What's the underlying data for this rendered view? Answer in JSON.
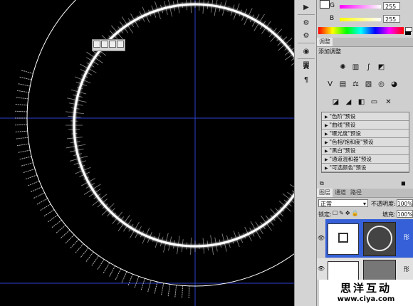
{
  "color_panel": {
    "g_label": "G",
    "g_value": "255",
    "b_label": "B",
    "b_value": "255"
  },
  "adjustments": {
    "tab_label": "调整",
    "title": "添加调整",
    "presets": [
      "\"色阶\"预设",
      "\"曲线\"预设",
      "\"曝光度\"预设",
      "\"色相/饱和度\"预设",
      "\"黑白\"预设",
      "\"通道混和器\"预设",
      "\"可选颜色\"预设"
    ]
  },
  "layers": {
    "tabs": [
      "图层",
      "通道",
      "路径"
    ],
    "blend_mode": "正常",
    "opacity_label": "不透明度:",
    "opacity_value": "100%",
    "lock_label": "锁定:",
    "fill_label": "填充:",
    "fill_value": "100%",
    "layer1_name": "形",
    "layer2_name": "形"
  },
  "watermark": {
    "title": "思洋互动",
    "url": "www.ciya.com"
  },
  "colors": {
    "canvas_bg": "#000000",
    "guide": "#2f3fd0",
    "panel_bg": "#cfcfcf",
    "selected_layer": "#3560d8"
  }
}
